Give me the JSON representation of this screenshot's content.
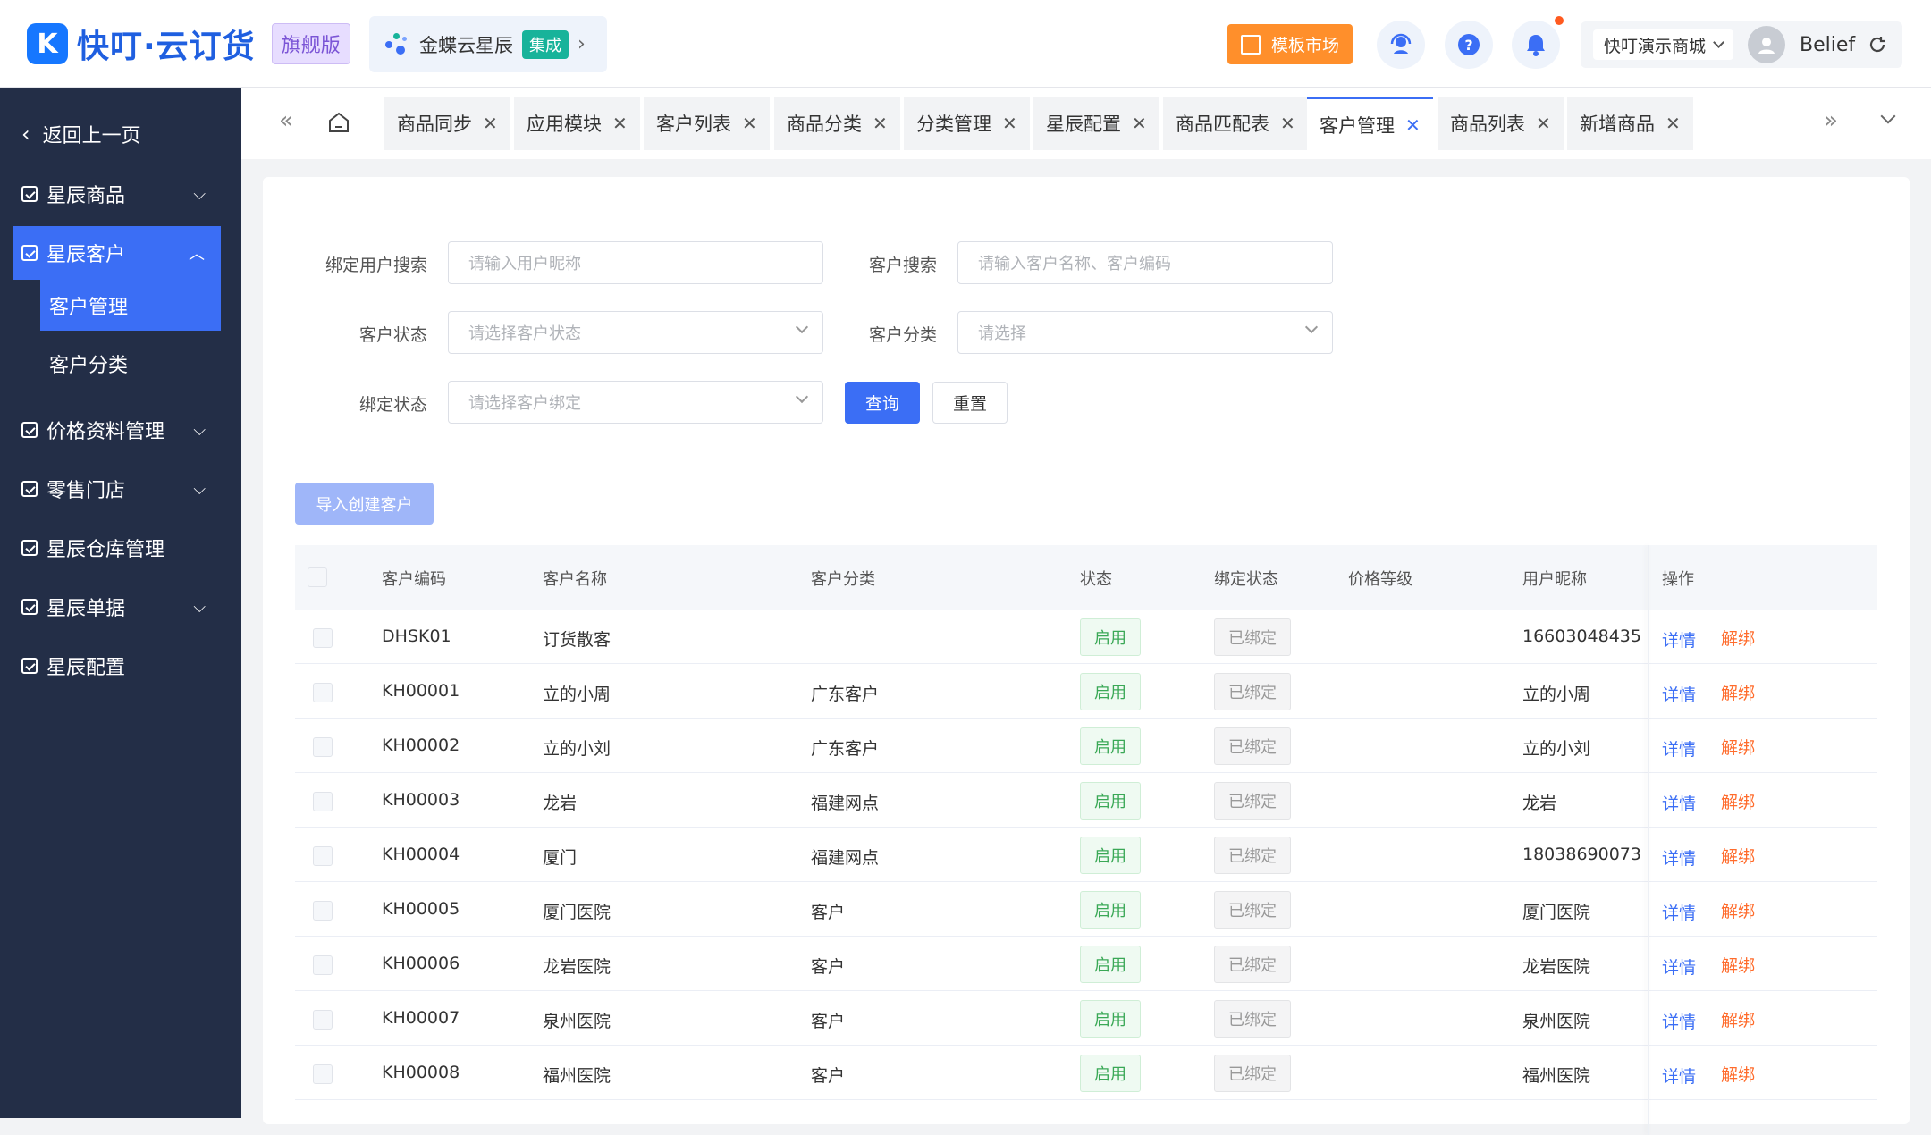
{
  "brand": {
    "name": "快叮·云订货",
    "edition": "旗舰版",
    "colors": {
      "primary": "#3b6ef5",
      "sidebar": "#232e47",
      "template_btn": "#ff8f2b",
      "success": "#3aa856",
      "warning": "#ff6b2b"
    }
  },
  "header": {
    "kingdee_link": "金蝶云星辰",
    "kingdee_badge": "集成",
    "template_market": "模板市场",
    "icons": [
      "service-icon",
      "help-icon",
      "bell-icon",
      "refresh-icon"
    ],
    "shop_name": "快叮演示商城",
    "user_name": "Belief"
  },
  "sidebar": {
    "back": "返回上一页",
    "items": [
      {
        "label": "星辰商品"
      },
      {
        "label": "星辰客户"
      },
      {
        "label": "价格资料管理"
      },
      {
        "label": "零售门店"
      },
      {
        "label": "星辰仓库管理"
      },
      {
        "label": "星辰单据"
      },
      {
        "label": "星辰配置"
      }
    ],
    "subitems": [
      {
        "label": "客户管理"
      },
      {
        "label": "客户分类"
      }
    ]
  },
  "tabs": [
    {
      "label": "商品同步"
    },
    {
      "label": "应用模块"
    },
    {
      "label": "客户列表"
    },
    {
      "label": "商品分类"
    },
    {
      "label": "分类管理"
    },
    {
      "label": "星辰配置"
    },
    {
      "label": "商品匹配表"
    },
    {
      "label": "客户管理"
    },
    {
      "label": "商品列表"
    },
    {
      "label": "新增商品"
    }
  ],
  "filters": {
    "bind_user_label": "绑定用户搜索",
    "bind_user_placeholder": "请输入用户昵称",
    "customer_search_label": "客户搜索",
    "customer_search_placeholder": "请输入客户名称、客户编码",
    "status_label": "客户状态",
    "status_placeholder": "请选择客户状态",
    "category_label": "客户分类",
    "category_placeholder": "请选择",
    "bind_status_label": "绑定状态",
    "bind_status_placeholder": "请选择客户绑定",
    "query": "查询",
    "reset": "重置"
  },
  "import_button": "导入创建客户",
  "table": {
    "columns": [
      "客户编码",
      "客户名称",
      "客户分类",
      "状态",
      "绑定状态",
      "价格等级",
      "用户昵称",
      "操作"
    ],
    "rows": [
      {
        "code": "DHSK01",
        "name": "订货散客",
        "category": "",
        "status": "启用",
        "bind": "已绑定",
        "level": "",
        "nick": "16603048435",
        "detail": "详情",
        "unbind": "解绑"
      },
      {
        "code": "KH00001",
        "name": "立的小周",
        "category": "广东客户",
        "status": "启用",
        "bind": "已绑定",
        "level": "",
        "nick": "立的小周",
        "detail": "详情",
        "unbind": "解绑"
      },
      {
        "code": "KH00002",
        "name": "立的小刘",
        "category": "广东客户",
        "status": "启用",
        "bind": "已绑定",
        "level": "",
        "nick": "立的小刘",
        "detail": "详情",
        "unbind": "解绑"
      },
      {
        "code": "KH00003",
        "name": "龙岩",
        "category": "福建网点",
        "status": "启用",
        "bind": "已绑定",
        "level": "",
        "nick": "龙岩",
        "detail": "详情",
        "unbind": "解绑"
      },
      {
        "code": "KH00004",
        "name": "厦门",
        "category": "福建网点",
        "status": "启用",
        "bind": "已绑定",
        "level": "",
        "nick": "18038690073",
        "detail": "详情",
        "unbind": "解绑"
      },
      {
        "code": "KH00005",
        "name": "厦门医院",
        "category": "客户",
        "status": "启用",
        "bind": "已绑定",
        "level": "",
        "nick": "厦门医院",
        "detail": "详情",
        "unbind": "解绑"
      },
      {
        "code": "KH00006",
        "name": "龙岩医院",
        "category": "客户",
        "status": "启用",
        "bind": "已绑定",
        "level": "",
        "nick": "龙岩医院",
        "detail": "详情",
        "unbind": "解绑"
      },
      {
        "code": "KH00007",
        "name": "泉州医院",
        "category": "客户",
        "status": "启用",
        "bind": "已绑定",
        "level": "",
        "nick": "泉州医院",
        "detail": "详情",
        "unbind": "解绑"
      },
      {
        "code": "KH00008",
        "name": "福州医院",
        "category": "客户",
        "status": "启用",
        "bind": "已绑定",
        "level": "",
        "nick": "福州医院",
        "detail": "详情",
        "unbind": "解绑"
      }
    ]
  }
}
